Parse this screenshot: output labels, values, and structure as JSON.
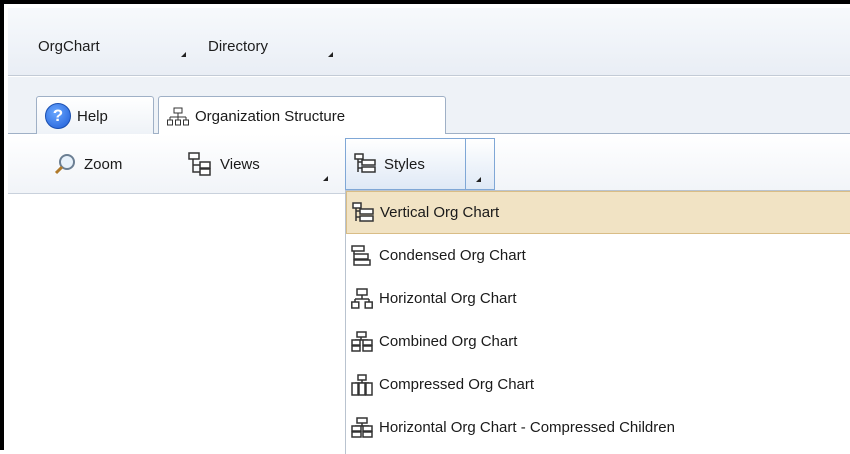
{
  "menubar": {
    "items": [
      {
        "label": "OrgChart"
      },
      {
        "label": "Directory"
      }
    ]
  },
  "tabs": [
    {
      "label": "Help",
      "icon": "help-icon"
    },
    {
      "label": "Organization Structure",
      "icon": "org-structure-icon"
    }
  ],
  "toolbar": {
    "zoom_label": "Zoom",
    "views_label": "Views",
    "styles_label": "Styles"
  },
  "styles_menu": {
    "selected_index": 0,
    "items": [
      {
        "label": "Vertical Org Chart",
        "icon": "vertical-org-chart-icon"
      },
      {
        "label": "Condensed Org Chart",
        "icon": "condensed-org-chart-icon"
      },
      {
        "label": "Horizontal Org Chart",
        "icon": "horizontal-org-chart-icon"
      },
      {
        "label": "Combined Org Chart",
        "icon": "combined-org-chart-icon"
      },
      {
        "label": "Compressed Org Chart",
        "icon": "compressed-org-chart-icon"
      },
      {
        "label": "Horizontal Org Chart - Compressed Children",
        "icon": "horizontal-compressed-children-icon"
      }
    ]
  },
  "colors": {
    "selection_bg": "#f1e3c4",
    "selection_border": "#d9bd86",
    "active_button_border": "#7fa7d6"
  }
}
